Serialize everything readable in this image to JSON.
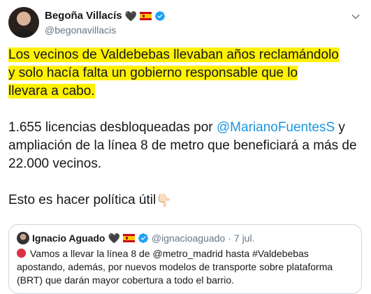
{
  "author": {
    "display_name": "Begoña Villacís",
    "handle": "@begonavillacis",
    "emoji_heart": "🖤"
  },
  "body": {
    "highlight_lines": [
      "Los vecinos de Valdebebas llevaban años reclamándolo",
      "y solo hacía falta un gobierno responsable que lo",
      "llevara a cabo."
    ],
    "para2_before": "1.655 licencias desbloqueadas por ",
    "para2_mention": "@MarianoFuentesS",
    "para2_after": " y ampliación de la línea 8 de metro que beneficiará a más de 22.000 vecinos.",
    "para3_text": "Esto es hacer política útil",
    "para3_emoji": "👇🏻"
  },
  "quoted": {
    "display_name": "Ignacio Aguado",
    "emoji_heart": "🖤",
    "handle": "@ignacioaguado",
    "dot": "·",
    "date": "7 jul.",
    "text": "Vamos a llevar la línea 8 de @metro_madrid hasta #Valdebebas apostando, además, por nuevos modelos de transporte sobre plataforma (BRT) que darán mayor cobertura a todo el barrio."
  },
  "colors": {
    "highlight": "#fff200",
    "link": "#1b95e0",
    "verified": "#1da1f2",
    "muted": "#657786",
    "border": "#ccd6dd"
  },
  "icons": [
    "verified-badge-icon",
    "spain-flag-icon",
    "chevron-down-icon",
    "red-circle-icon",
    "pointing-down-hand-icon"
  ]
}
